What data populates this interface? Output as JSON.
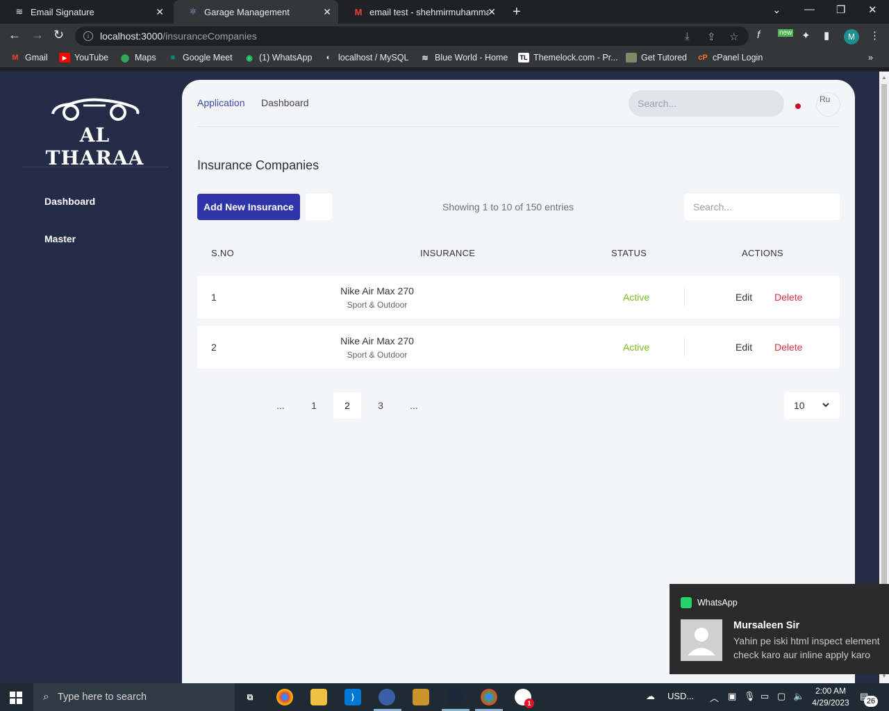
{
  "browser": {
    "tabs": [
      {
        "title": "Email Signature",
        "active": false
      },
      {
        "title": "Garage Management",
        "active": true
      },
      {
        "title": "email test - shehmirmuhammad@",
        "active": false
      }
    ],
    "url_host": "localhost:3000",
    "url_path": "/insuranceCompanies",
    "profile_initial": "M",
    "ext_new_label": "new",
    "bookmarks": [
      "Gmail",
      "YouTube",
      "Maps",
      "Google Meet",
      "(1) WhatsApp",
      "localhost / MySQL",
      "Blue World - Home",
      "Themelock.com - Pr...",
      "Get Tutored",
      "cPanel Login"
    ]
  },
  "sidebar": {
    "brand": "AL THARAA",
    "items": [
      "Dashboard",
      "Master"
    ]
  },
  "header": {
    "breadcrumb_app": "Application",
    "breadcrumb_dashboard": "Dashboard",
    "search_placeholder": "Search...",
    "avatar_alt": "Ru"
  },
  "page": {
    "title": "Insurance Companies",
    "add_button": "Add New Insurance",
    "entries_info": "Showing 1 to 10 of 150 entries",
    "search_placeholder": "Search..."
  },
  "table": {
    "columns": [
      "S.NO",
      "INSURANCE",
      "STATUS",
      "ACTIONS"
    ],
    "rows": [
      {
        "sno": "1",
        "name": "Nike Air Max 270",
        "category": "Sport & Outdoor",
        "status": "Active",
        "edit": "Edit",
        "delete": "Delete"
      },
      {
        "sno": "2",
        "name": "Nike Air Max 270",
        "category": "Sport & Outdoor",
        "status": "Active",
        "edit": "Edit",
        "delete": "Delete"
      }
    ]
  },
  "pagination": {
    "pages": [
      "...",
      "1",
      "2",
      "3",
      "..."
    ],
    "current": "2",
    "per_page": "10"
  },
  "notification": {
    "app": "WhatsApp",
    "sender": "Mursaleen Sir",
    "message_line1": "Yahin pe iski html inspect element",
    "message_line2": "check karo aur inline apply karo"
  },
  "taskbar": {
    "search_placeholder": "Type here to search",
    "weather": "USD...",
    "time": "2:00 AM",
    "date": "4/29/2023",
    "notification_count": "26",
    "whatsapp_badge": "1"
  },
  "colors": {
    "sidebar_bg": "#252c47",
    "primary": "#2f35a8",
    "status_active": "#7bbd18",
    "delete": "#d6303c"
  }
}
